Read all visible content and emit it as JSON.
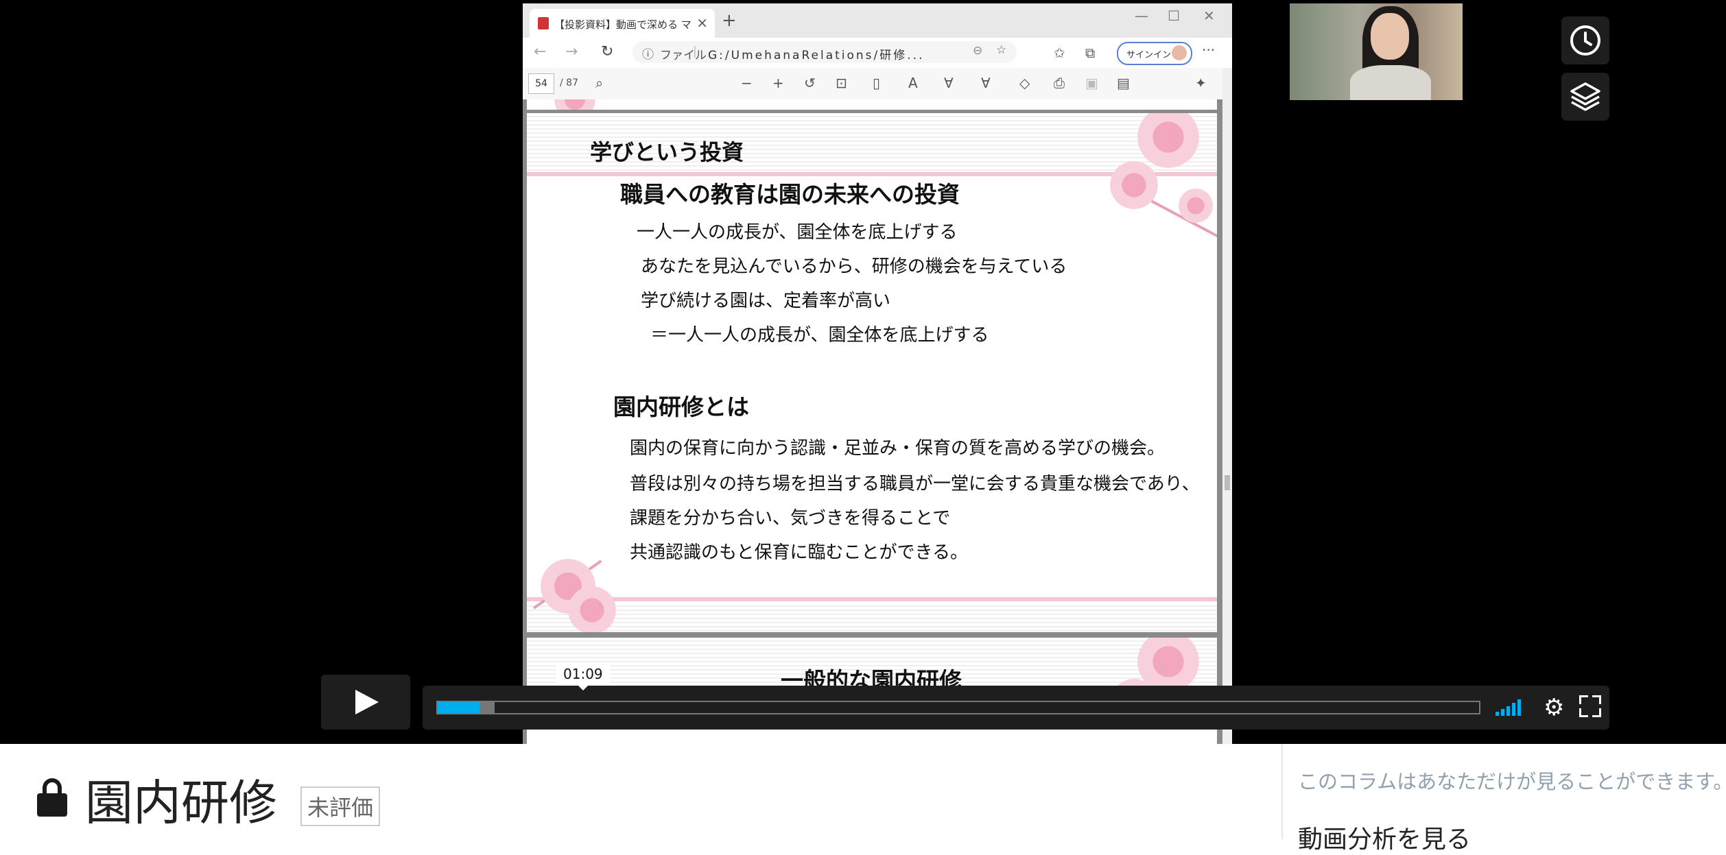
{
  "browser": {
    "tab_title": "【投影資料】動画で深める マネジメ",
    "tab_close": "×",
    "new_tab": "+",
    "minimize": "—",
    "maximize": "☐",
    "close": "✕",
    "back": "←",
    "forward": "→",
    "reload": "↻",
    "info_icon": "ⓘ",
    "file_label": "ファイル",
    "url": "G:/UmehanaRelations/研修...",
    "signin_label": "サインイン",
    "more": "···"
  },
  "pdf_toolbar": {
    "page_number": "54",
    "page_total": "/ 87"
  },
  "slide1": {
    "title": "学びという投資",
    "heading1": "職員への教育は園の未来への投資",
    "lines1": [
      "一人一人の成長が、園全体を底上げする",
      "あなたを見込んでいるから、研修の機会を与えている",
      "学び続ける園は、定着率が高い",
      "＝一人一人の成長が、園全体を底上げする"
    ],
    "heading2": "園内研修とは",
    "lines2": [
      "園内の保育に向かう認識・足並み・保育の質を高める学びの機会。",
      "普段は別々の持ち場を担当する職員が一堂に会する貴重な機会であり、",
      "課題を分かち合い、気づきを得ることで",
      "共通認識のもと保育に臨むことができる。"
    ]
  },
  "slide2": {
    "title": "一般的な園内研修"
  },
  "player": {
    "time_tooltip": "01:09",
    "played_fraction": 0.04,
    "loaded_fraction": 0.055,
    "accent_color": "#00adef"
  },
  "page": {
    "title": "園内研修",
    "badge": "未評価",
    "side_note": "このコラムはあなただけが見ることができます。",
    "side_link": "動画分析を見る"
  }
}
